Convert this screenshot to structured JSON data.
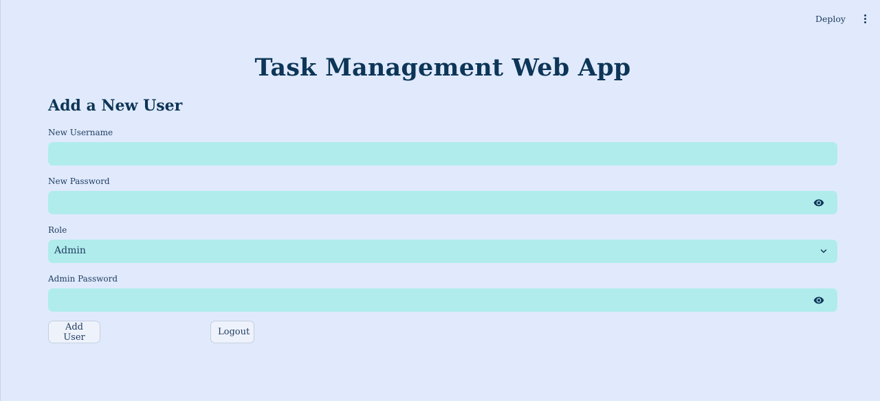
{
  "topbar": {
    "deploy_label": "Deploy",
    "menu_icon": "kebab-menu-icon"
  },
  "page": {
    "title": "Task Management Web App",
    "subtitle": "Add a New User"
  },
  "form": {
    "username": {
      "label": "New Username",
      "value": ""
    },
    "password": {
      "label": "New Password",
      "value": "",
      "toggle_icon": "eye-icon"
    },
    "role": {
      "label": "Role",
      "selected": "Admin",
      "dropdown_icon": "chevron-down-icon"
    },
    "admin_password": {
      "label": "Admin Password",
      "value": "",
      "toggle_icon": "eye-icon"
    }
  },
  "buttons": {
    "add_user": "Add User",
    "logout": "Logout"
  },
  "colors": {
    "background": "#e0eafc",
    "input_background": "#b0ecec",
    "text": "#0d3557",
    "button_background": "#eef2fb"
  }
}
